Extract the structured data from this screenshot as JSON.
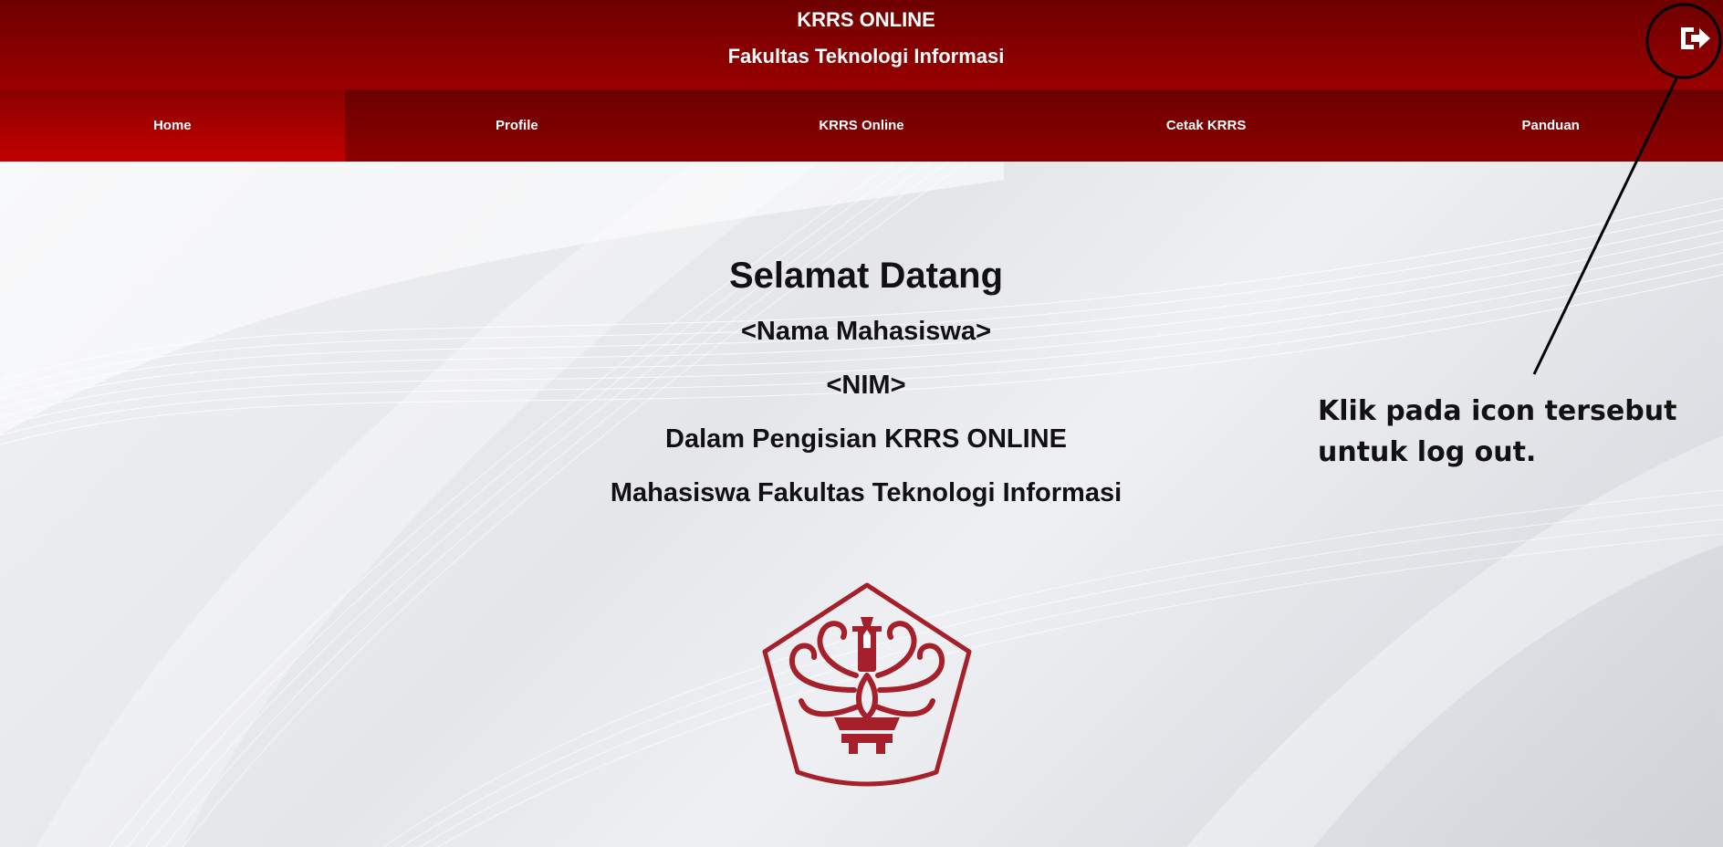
{
  "header": {
    "title": "KRRS ONLINE",
    "subtitle": "Fakultas Teknologi Informasi",
    "logout_icon": "sign-out-icon"
  },
  "nav": {
    "items": [
      {
        "label": "Home",
        "active": true
      },
      {
        "label": "Profile",
        "active": false
      },
      {
        "label": "KRRS Online",
        "active": false
      },
      {
        "label": "Cetak KRRS",
        "active": false
      },
      {
        "label": "Panduan",
        "active": false
      }
    ]
  },
  "welcome": {
    "title": "Selamat Datang",
    "name": "<Nama Mahasiswa>",
    "nim": "<NIM>",
    "line1": "Dalam Pengisian KRRS ONLINE",
    "line2": "Mahasiswa Fakultas Teknologi Informasi"
  },
  "annotation": {
    "text_line1": "Klik pada icon tersebut",
    "text_line2": "untuk log out."
  },
  "colors": {
    "header_dark": "#6e0000",
    "header_light": "#9a0000",
    "nav_active": "#c20000",
    "emblem": "#a5202a"
  }
}
